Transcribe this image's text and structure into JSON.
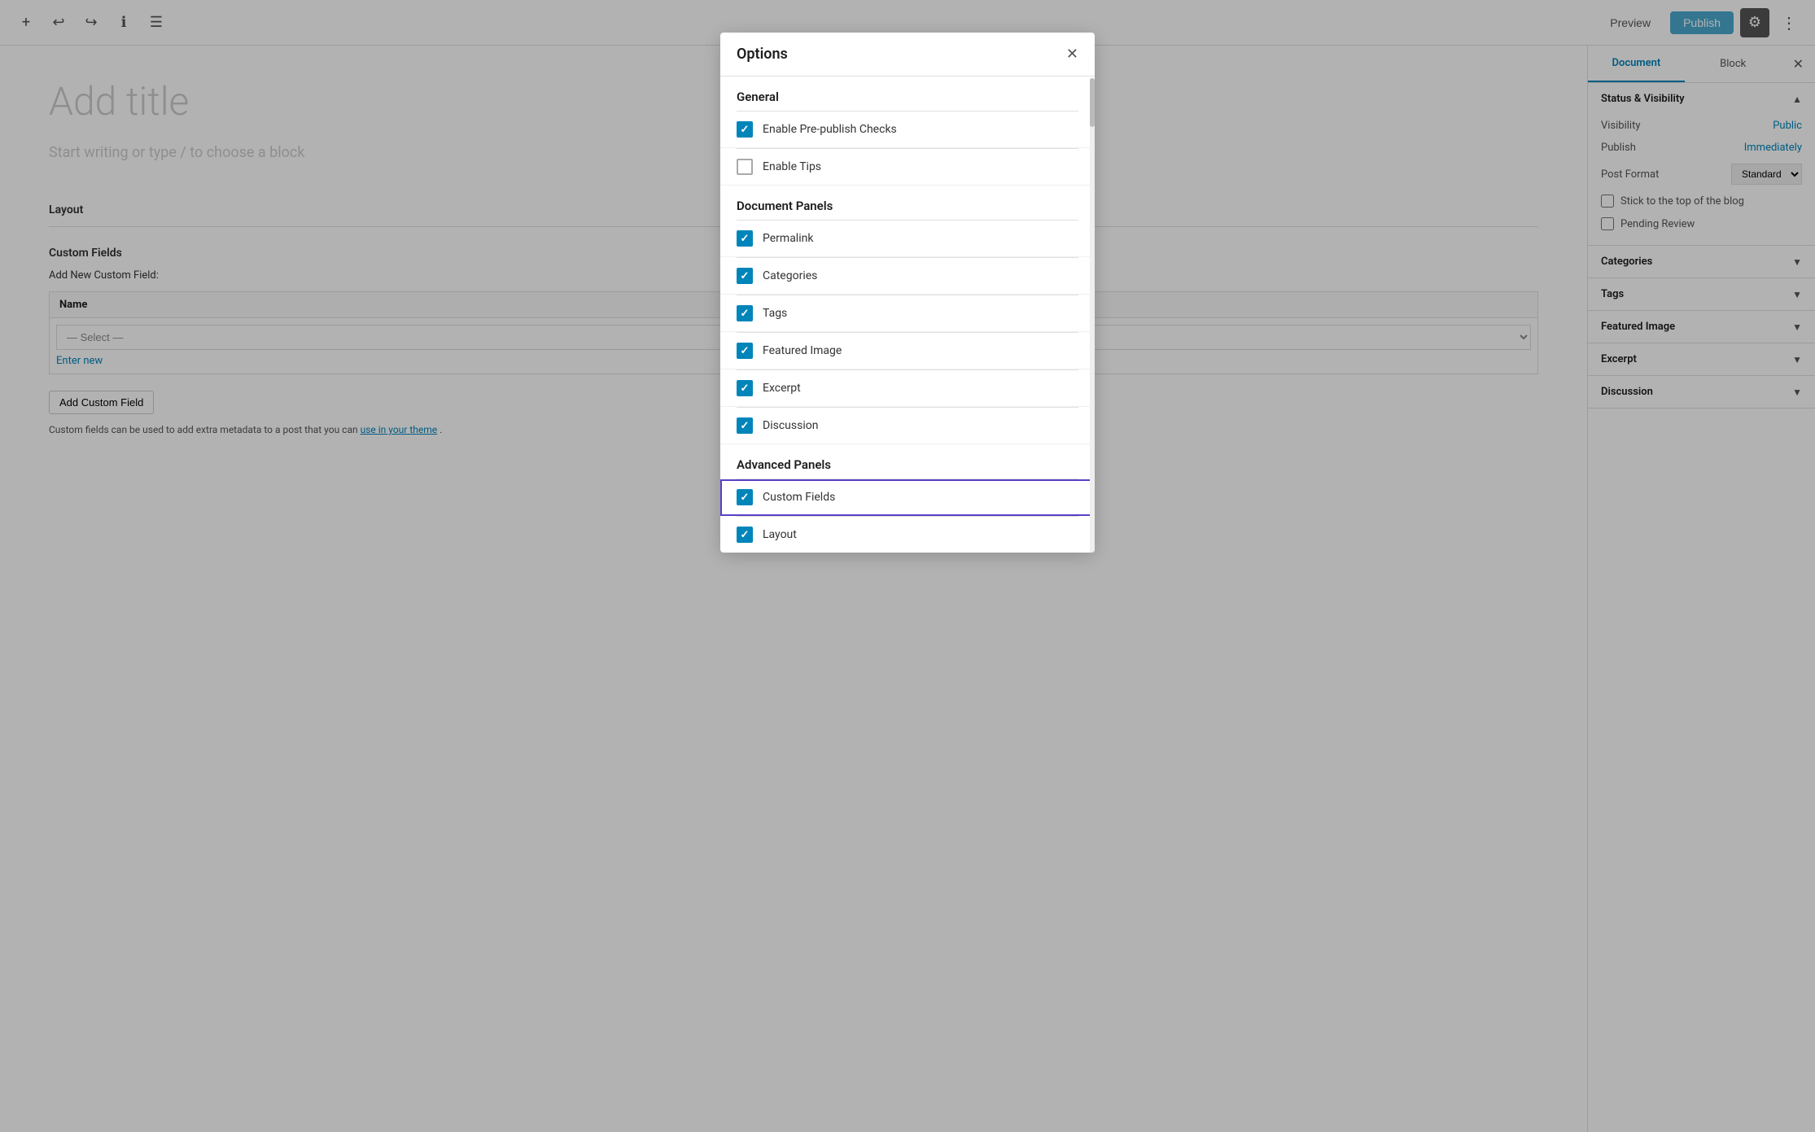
{
  "toolbar": {
    "preview_label": "Preview",
    "publish_label": "Publish",
    "undo_icon": "↩",
    "redo_icon": "↪",
    "info_icon": "ℹ",
    "menu_icon": "☰",
    "plus_icon": "+",
    "gear_icon": "⚙",
    "dots_icon": "⋮"
  },
  "editor": {
    "title_placeholder": "Add title",
    "subtitle_placeholder": "Start writing or type / to choose a block"
  },
  "meta_boxes": {
    "layout_label": "Layout",
    "custom_fields_label": "Custom Fields",
    "add_new_label": "Add New Custom Field:",
    "name_column": "Name",
    "select_placeholder": "— Select —",
    "enter_new_label": "Enter new",
    "add_cf_button": "Add Custom Field",
    "footer_text": "Custom fields can be used to add extra metadata to a post that you can",
    "footer_link_text": "use in your theme",
    "footer_period": "."
  },
  "sidebar": {
    "tab_document": "Document",
    "tab_block": "Block",
    "close_icon": "✕",
    "sections": [
      {
        "id": "status-visibility",
        "label": "Status & Visibility",
        "expanded": true,
        "chevron": "▲"
      },
      {
        "id": "categories",
        "label": "Categories",
        "expanded": false,
        "chevron": "▼"
      },
      {
        "id": "tags",
        "label": "Tags",
        "expanded": false,
        "chevron": "▼"
      },
      {
        "id": "featured-image",
        "label": "Featured Image",
        "expanded": false,
        "chevron": "▼"
      },
      {
        "id": "excerpt",
        "label": "Excerpt",
        "expanded": false,
        "chevron": "▼"
      },
      {
        "id": "discussion",
        "label": "Discussion",
        "expanded": false,
        "chevron": "▼"
      }
    ],
    "visibility_label": "Visibility",
    "visibility_value": "Public",
    "publish_label": "Publish",
    "publish_value": "Immediately",
    "post_format_label": "Post Format",
    "post_format_value": "Standard",
    "stick_label": "Stick to the top of the blog",
    "pending_label": "Pending Review"
  },
  "modal": {
    "title": "Options",
    "close_icon": "✕",
    "general_title": "General",
    "document_panels_title": "Document Panels",
    "advanced_panels_title": "Advanced Panels",
    "options": {
      "general": [
        {
          "id": "pre-publish",
          "label": "Enable Pre-publish Checks",
          "checked": true
        },
        {
          "id": "tips",
          "label": "Enable Tips",
          "checked": false
        }
      ],
      "document_panels": [
        {
          "id": "permalink",
          "label": "Permalink",
          "checked": true
        },
        {
          "id": "categories",
          "label": "Categories",
          "checked": true
        },
        {
          "id": "tags",
          "label": "Tags",
          "checked": true
        },
        {
          "id": "featured-image",
          "label": "Featured Image",
          "checked": true
        },
        {
          "id": "excerpt",
          "label": "Excerpt",
          "checked": true
        },
        {
          "id": "discussion",
          "label": "Discussion",
          "checked": true
        }
      ],
      "advanced_panels": [
        {
          "id": "custom-fields",
          "label": "Custom Fields",
          "checked": true,
          "highlighted": true
        },
        {
          "id": "layout",
          "label": "Layout",
          "checked": true
        }
      ]
    }
  }
}
